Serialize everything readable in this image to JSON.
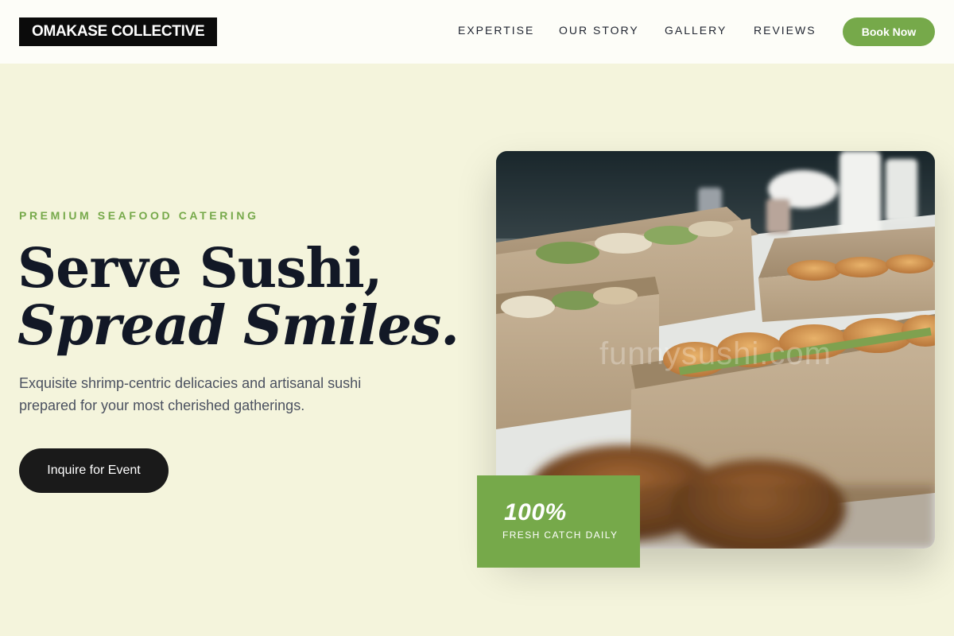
{
  "brand": {
    "logo": "OMAKASE COLLECTIVE"
  },
  "nav": {
    "items": [
      {
        "label": "EXPERTISE"
      },
      {
        "label": "OUR STORY"
      },
      {
        "label": "GALLERY"
      },
      {
        "label": "REVIEWS"
      }
    ],
    "cta_label": "Book Now"
  },
  "hero": {
    "eyebrow": "PREMIUM SEAFOOD CATERING",
    "headline_line1": "Serve Sushi,",
    "headline_line2": "Spread Smiles.",
    "subcopy": "Exquisite shrimp-centric delicacies and artisanal sushi prepared for your most cherished gatherings.",
    "cta_label": "Inquire for Event"
  },
  "photo": {
    "watermark": "funnysushi.com"
  },
  "stat": {
    "value": "100%",
    "label": "FRESH CATCH DAILY"
  },
  "colors": {
    "accent": "#76a94a",
    "background": "#f4f4dc",
    "header": "#fdfdf8",
    "dark": "#1a1a1a"
  }
}
